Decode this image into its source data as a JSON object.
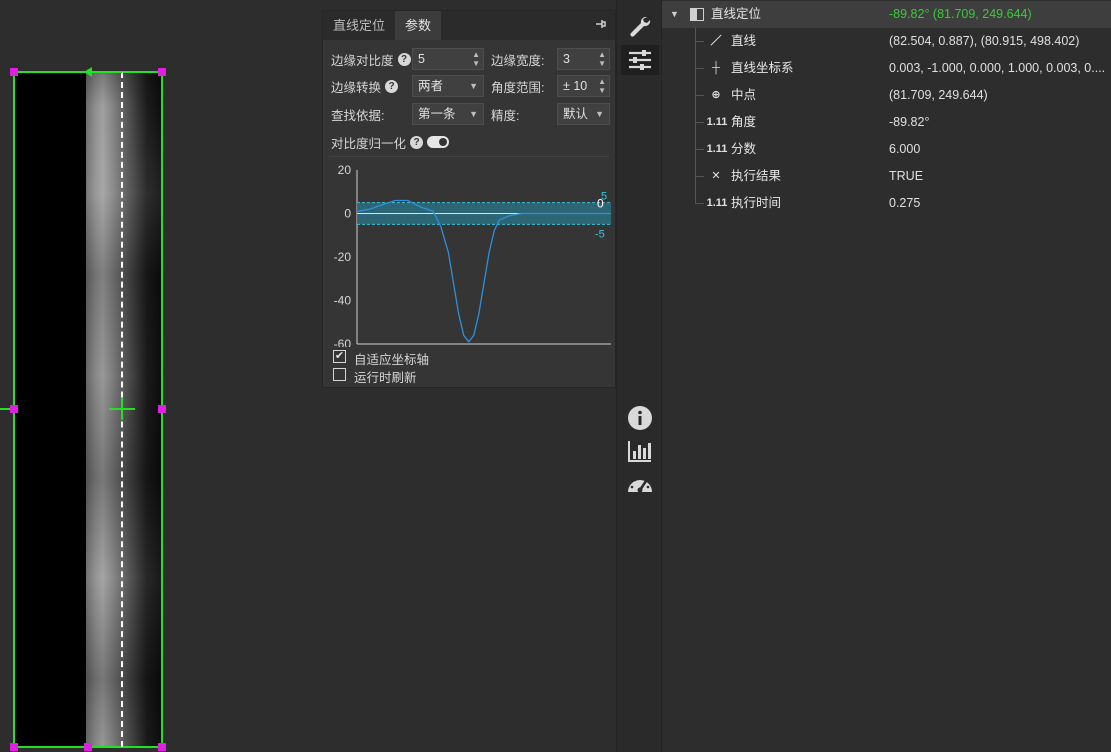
{
  "panel": {
    "tabs": [
      "直线定位",
      "参数"
    ],
    "active_tab": "参数",
    "edge_contrast": {
      "label": "边缘对比度",
      "value": "5"
    },
    "edge_width": {
      "label": "边缘宽度:",
      "value": "3"
    },
    "edge_transition": {
      "label": "边缘转换",
      "value": "两者"
    },
    "angle_range": {
      "label": "角度范围:",
      "value": "± 10"
    },
    "find_by": {
      "label": "查找依据:",
      "value": "第一条"
    },
    "precision": {
      "label": "精度:",
      "value": "默认"
    },
    "contrast_normalize": {
      "label": "对比度归一化",
      "enabled": true
    },
    "adaptive_axis": {
      "label": "自适应坐标轴",
      "checked": true
    },
    "refresh_on_run": {
      "label": "运行时刷新",
      "checked": false
    }
  },
  "chart_data": {
    "type": "line",
    "title": "",
    "xlabel": "",
    "ylabel": "",
    "ylim": [
      -60,
      20
    ],
    "yticks": [
      "20",
      "0",
      "-20",
      "-40",
      "-60"
    ],
    "threshold_band": {
      "upper": 5,
      "lower": -5,
      "upper_label": "5",
      "lower_label": "-5",
      "zero_label": "0"
    },
    "series": [
      {
        "x": [
          0,
          5,
          10,
          15,
          20,
          25,
          30,
          33,
          36,
          38,
          40,
          42,
          44,
          46,
          48,
          50,
          52,
          54,
          56,
          60,
          65,
          70,
          80,
          90,
          100
        ],
        "values": [
          1,
          2,
          4,
          6,
          6,
          3,
          1,
          -6,
          -18,
          -32,
          -46,
          -56,
          -59,
          -56,
          -46,
          -32,
          -18,
          -8,
          -3,
          -1,
          0,
          0,
          0,
          0,
          0
        ]
      }
    ],
    "colors": {
      "line": "#2f8fd8",
      "band": "#2a6e80",
      "band_border": "#37c6dc"
    },
    "grid": false
  },
  "toolbar": {
    "tools": [
      "wrench-icon",
      "sliders-icon",
      "info-icon",
      "bar-chart-icon",
      "gauge-icon"
    ],
    "active": "sliders-icon"
  },
  "tree": {
    "root": {
      "name": "直线定位",
      "value": "-89.82° (81.709, 249.644)"
    },
    "items": [
      {
        "icon": "／",
        "name": "直线",
        "value": "(82.504, 0.887), (80.915, 498.402)"
      },
      {
        "icon": "┼",
        "name": "直线坐标系",
        "value": "0.003, -1.000, 0.000, 1.000, 0.003, 0...."
      },
      {
        "icon": "⊕",
        "name": "中点",
        "value": "(81.709, 249.644)"
      },
      {
        "icon": "1.11",
        "name": "角度",
        "value": "-89.82°"
      },
      {
        "icon": "1.11",
        "name": "分数",
        "value": "6.000"
      },
      {
        "icon": "✕",
        "name": "执行结果",
        "value": "TRUE"
      },
      {
        "icon": "1.11",
        "name": "执行时间",
        "value": "0.275"
      }
    ]
  }
}
